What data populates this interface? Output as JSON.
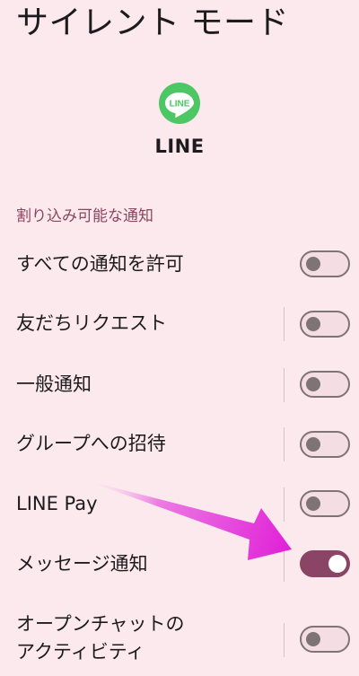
{
  "title": "サイレント モード",
  "app": {
    "name": "LINE",
    "logo_text": "LINE",
    "logo_color": "#4cc764"
  },
  "section": {
    "header": "割り込み可能な通知"
  },
  "rows": [
    {
      "label": "すべての通知を許可",
      "enabled": false
    },
    {
      "label": "友だちリクエスト",
      "enabled": false
    },
    {
      "label": "一般通知",
      "enabled": false
    },
    {
      "label": "グループへの招待",
      "enabled": false
    },
    {
      "label": "LINE Pay",
      "enabled": false
    },
    {
      "label": "メッセージ通知",
      "enabled": true
    },
    {
      "label_line1": "オープンチャットの",
      "label_line2": "アクティビティ",
      "enabled": false
    }
  ],
  "colors": {
    "background": "#fbe9ee",
    "accent": "#8a4465",
    "section_header": "#8a4660",
    "annotation_arrow": "#e020d8"
  },
  "annotation": {
    "icon": "arrow-annotation-icon"
  }
}
